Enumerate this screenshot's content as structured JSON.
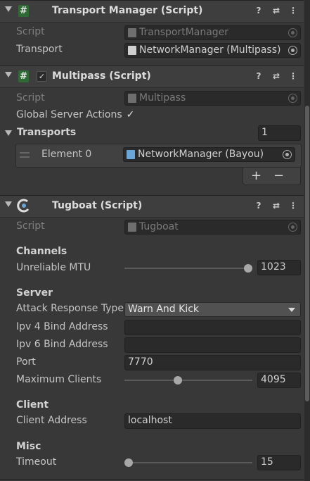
{
  "transport_manager": {
    "title": "Transport Manager (Script)",
    "script_label": "Script",
    "script_value": "TransportManager",
    "transport_label": "Transport",
    "transport_value": "NetworkManager (Multipass)"
  },
  "multipass": {
    "title": "Multipass (Script)",
    "script_label": "Script",
    "script_value": "Multipass",
    "global_actions_label": "Global Server Actions",
    "global_actions_checked": true,
    "transports_label": "Transports",
    "transports_count": "1",
    "element_label": "Element 0",
    "element_value": "NetworkManager (Bayou)",
    "add_label": "+",
    "remove_label": "−"
  },
  "tugboat": {
    "title": "Tugboat (Script)",
    "script_label": "Script",
    "script_value": "Tugboat",
    "channels_header": "Channels",
    "unreliable_mtu_label": "Unreliable MTU",
    "unreliable_mtu_value": "1023",
    "unreliable_mtu_fraction": 1.0,
    "server_header": "Server",
    "attack_response_label": "Attack Response Type",
    "attack_response_value": "Warn And Kick",
    "ipv4_label": "Ipv 4 Bind Address",
    "ipv4_value": "",
    "ipv6_label": "Ipv 6 Bind Address",
    "ipv6_value": "",
    "port_label": "Port",
    "port_value": "7770",
    "max_clients_label": "Maximum Clients",
    "max_clients_value": "4095",
    "max_clients_fraction": 0.41,
    "client_header": "Client",
    "client_address_label": "Client Address",
    "client_address_value": "localhost",
    "misc_header": "Misc",
    "timeout_label": "Timeout",
    "timeout_value": "15",
    "timeout_fraction": 0.0
  },
  "icons": {
    "help": "?",
    "presets": "⇄",
    "menu": "⋮",
    "check": "✓"
  },
  "colors": {
    "background": "#383838",
    "header": "#3e3e3e",
    "field": "#2a2a2a",
    "script_icon": "#2f6a36"
  }
}
